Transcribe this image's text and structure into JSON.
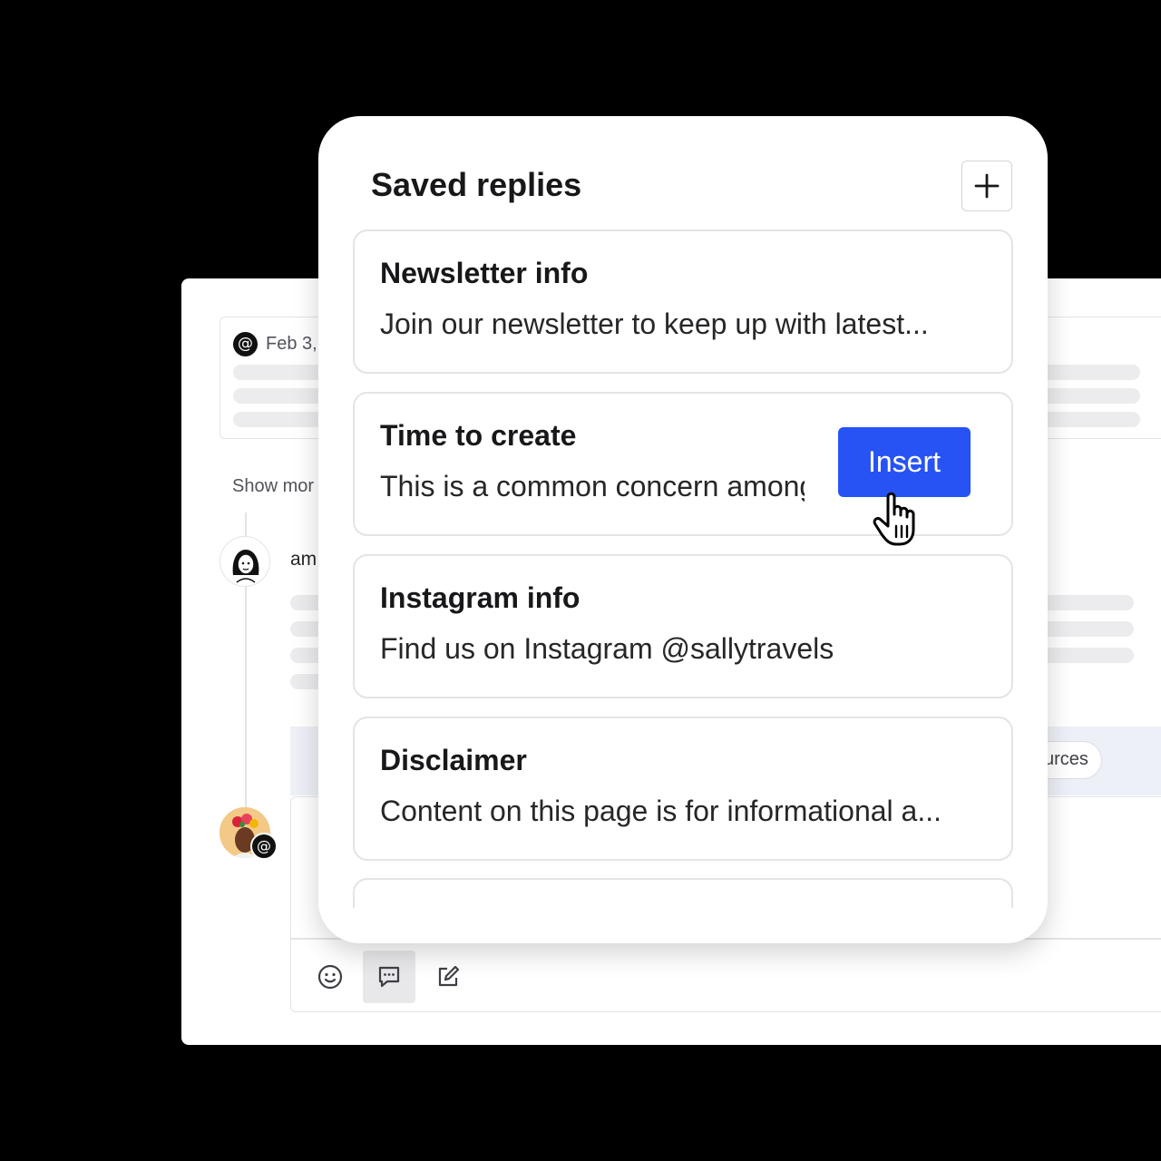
{
  "background_app": {
    "post": {
      "network_icon": "threads-icon",
      "date_text": "Feb 3,"
    },
    "show_more_text": "Show mor",
    "author_name_text": "am",
    "sources_chip_text": "urces",
    "composer_toolbar": {
      "icons": [
        "emoji-icon",
        "saved-replies-icon",
        "edit-icon"
      ]
    }
  },
  "saved_replies": {
    "title": "Saved replies",
    "add_icon": "plus-icon",
    "items": [
      {
        "title": "Newsletter info",
        "preview": "Join our newsletter to keep up with latest..."
      },
      {
        "title": "Time to create",
        "preview": "This is a common concern among",
        "action_label": "Insert"
      },
      {
        "title": "Instagram info",
        "preview": "Find us on Instagram @sallytravels"
      },
      {
        "title": "Disclaimer",
        "preview": "Content on this page is for informational a..."
      }
    ]
  },
  "colors": {
    "page_background": "#000000",
    "accent": "#2753f5",
    "card_border": "#e4e4e7"
  }
}
